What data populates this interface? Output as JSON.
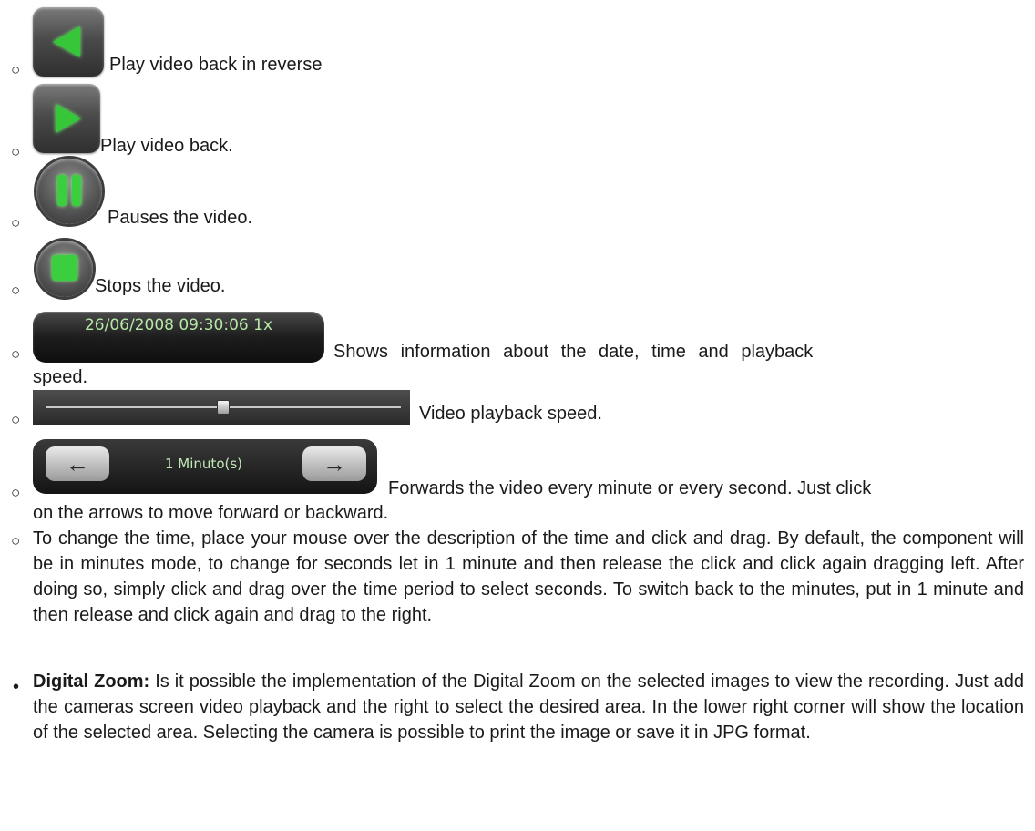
{
  "items": [
    {
      "icon": "reverse-play-icon",
      "text": "Play video back in reverse"
    },
    {
      "icon": "play-icon",
      "text": "Play video back."
    },
    {
      "icon": "pause-icon",
      "text": "Pauses the video."
    },
    {
      "icon": "stop-icon",
      "text": "Stops the video."
    },
    {
      "icon": "info-display",
      "display": "26/06/2008 09:30:06 1x",
      "text_line1": "Shows information about the date, time and playback",
      "text_line2": "speed."
    },
    {
      "icon": "speed-slider",
      "text": "Video playback speed."
    },
    {
      "icon": "time-stepper",
      "display": "1 Minuto(s)",
      "text_line1": "Forwards the video every minute or every second. Just click",
      "text_line2": "on the arrows to move forward or backward."
    }
  ],
  "time_paragraph": "To change the time, place your mouse over the description of the time and click and drag. By default, the component will be in minutes mode, to change for seconds let in 1 minute and then release the click and click again dragging left. After doing so, simply click and drag over the time period to select seconds. To switch back to the minutes, put in 1 minute and then release and click again and drag to the right.",
  "zoom": {
    "title": "Digital Zoom:",
    "text": " Is it possible the implementation of the Digital Zoom on the selected images to view the recording. Just add the cameras screen video playback and the right to select the desired area. In the lower right corner will show the location of the selected area. Selecting the camera is possible to print the image or save it in JPG format."
  },
  "bullets": {
    "circle": "○",
    "disc": "•"
  },
  "colors": {
    "icon_green": "#37c53a",
    "display_text": "#b6e8a6"
  }
}
